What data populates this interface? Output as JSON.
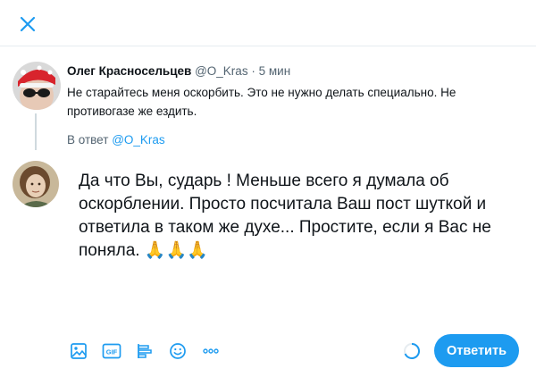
{
  "modal": {
    "close_icon": "close-icon",
    "accent_color": "#1d9bf0"
  },
  "original_tweet": {
    "author_name": "Олег Красносельцев",
    "handle": "@O_Kras",
    "separator": "·",
    "time": "5 мин",
    "text": "Не старайтесь меня оскорбить. Это не нужно делать специально. Не противогазе же ездить."
  },
  "reply_context": {
    "prefix": "В ответ",
    "mention": "@O_Kras"
  },
  "compose": {
    "text": "Да что Вы, сударь ! Меньше всего я думала об оскорблении. Просто посчитала Ваш пост шуткой и ответила в таком же духе... Простите, если я Вас не поняла.",
    "emoji": "🙏🙏🙏"
  },
  "toolbar": {
    "icons": [
      "image-icon",
      "gif-icon",
      "poll-icon",
      "emoji-icon",
      "more-icon"
    ],
    "gif_label": "GIF",
    "reply_label": "Ответить"
  }
}
